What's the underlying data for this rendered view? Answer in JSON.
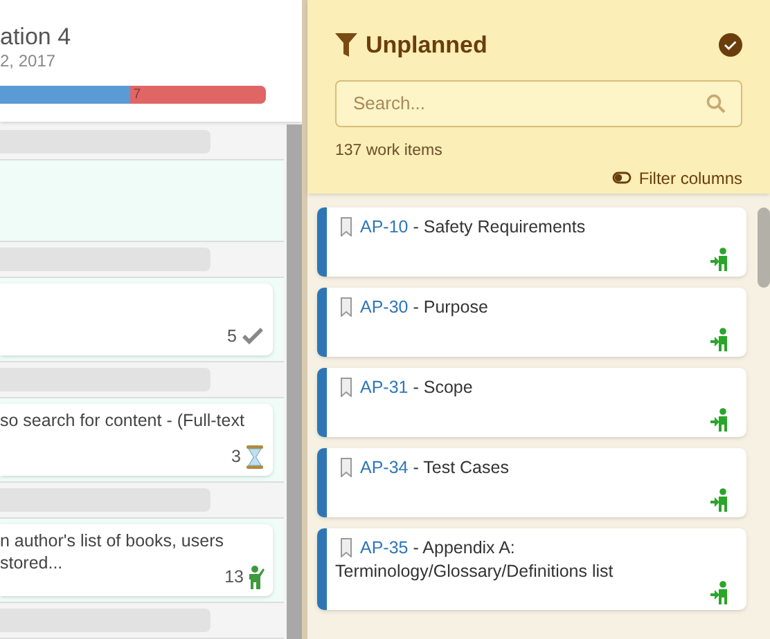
{
  "left_panel": {
    "title": "ation 4",
    "date": "2, 2017",
    "progress": {
      "level": 0.49,
      "remaining_label": "7"
    },
    "lanes": [
      {
        "kind": "header"
      },
      {
        "kind": "empty"
      },
      {
        "kind": "header"
      },
      {
        "kind": "done",
        "count": "5"
      },
      {
        "kind": "header"
      },
      {
        "kind": "waiting",
        "lines": [
          "so search for content - (Full-text"
        ],
        "count": "3"
      },
      {
        "kind": "header"
      },
      {
        "kind": "person",
        "lines": [
          "n author's list of books, users",
          "stored..."
        ],
        "count": "13"
      },
      {
        "kind": "header"
      }
    ]
  },
  "unplanned": {
    "title": "Unplanned",
    "complete": true,
    "search": {
      "placeholder": "Search..."
    },
    "count": "137 work items",
    "filter_label": "Filter columns",
    "items": [
      {
        "key": "AP-10",
        "title": "- Safety Requirements"
      },
      {
        "key": "AP-30",
        "title": "- Purpose"
      },
      {
        "key": "AP-31",
        "title": "- Scope"
      },
      {
        "key": "AP-34",
        "title": "- Test Cases"
      },
      {
        "key": "AP-35",
        "title": "- Appendix A: Terminology/Glossary/Definitions list"
      }
    ]
  }
}
